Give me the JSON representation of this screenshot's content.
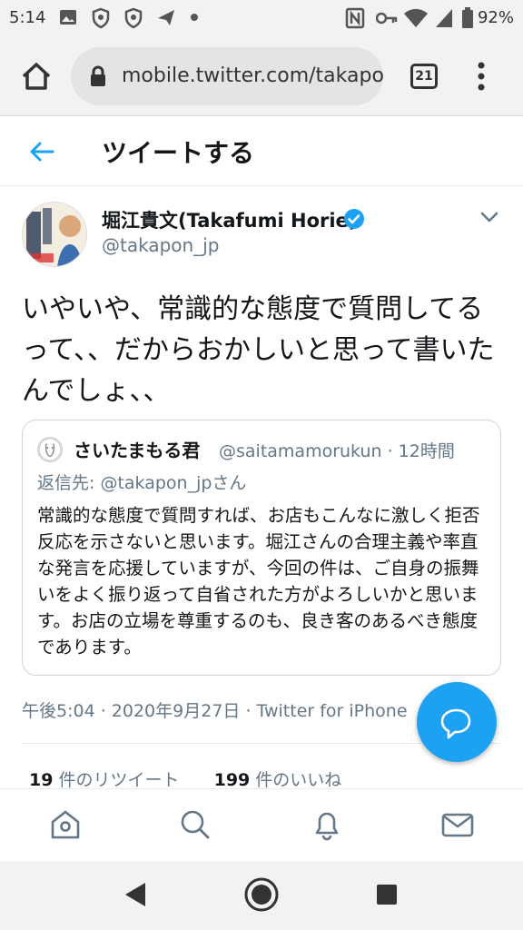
{
  "status_bar": {
    "time": "5:14",
    "battery": "92%",
    "icons": [
      "image-icon",
      "shield-icon",
      "shield-icon",
      "paper-plane-icon",
      "dot-icon",
      "nfc-icon",
      "key-icon",
      "wifi-icon",
      "signal-icon",
      "battery-icon"
    ]
  },
  "browser": {
    "url": "mobile.twitter.com/takapon_",
    "tab_count": "21"
  },
  "header": {
    "title": "ツイートする"
  },
  "tweet": {
    "author_name": "堀江貴文(Takafumi Horie)",
    "author_handle": "@takapon_jp",
    "text": "いやいや、常識的な態度で質問してるって、、だからおかしいと思って書いたんでしょ、、",
    "quote": {
      "name": "さいたまもる君",
      "handle_time": "@saitamamorukun · 12時間",
      "reply_to": "返信先: @takapon_jpさん",
      "text": "常識的な態度で質問すれば、お店もこんなに激しく拒否反応を示さないと思います。堀江さんの合理主義や率直な発言を応援していますが、今回の件は、ご自身の振舞いをよく振り返って自省された方がよろしいかと思います。お店の立場を尊重するのも、良き客のあるべき態度であります。"
    },
    "meta": "午後5:04 · 2020年9月27日 · Twitter for iPhone",
    "retweets": "19",
    "retweets_label": " 件のリツイート",
    "likes": "199",
    "likes_label": " 件のいいね"
  },
  "colors": {
    "accent": "#1da1f2",
    "secondary_text": "#657786",
    "primary_text": "#14171a",
    "border": "#e6ecf0"
  }
}
